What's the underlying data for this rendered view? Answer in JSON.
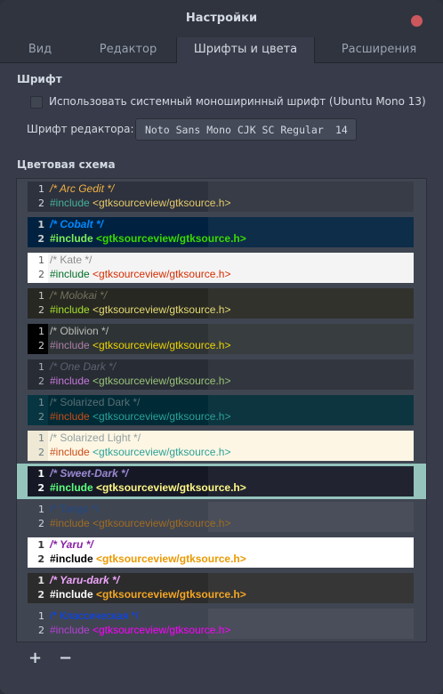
{
  "window": {
    "title": "Настройки"
  },
  "tabs": [
    {
      "label": "Вид"
    },
    {
      "label": "Редактор"
    },
    {
      "label": "Шрифты и цвета"
    },
    {
      "label": "Расширения"
    }
  ],
  "font_section": {
    "heading": "Шрифт",
    "system_font_checkbox": {
      "label": "Использовать системный моноширинный шрифт (Ubuntu Mono 13)",
      "checked": false
    },
    "editor_font_label": "Шрифт редактора:",
    "editor_font": {
      "name": "Noto Sans Mono CJK SC Regular",
      "size": "14"
    }
  },
  "scheme_section": {
    "heading": "Цветовая схема",
    "include_keyword": "#include",
    "include_path": "<gtksourceview/gtksource.h>",
    "schemes": [
      {
        "name": "/* Arc Gedit */",
        "bg": "#2d323e",
        "gutter": "#2d323e",
        "ln": "#d3dae3",
        "comment": "#f3b144",
        "italic": true,
        "kw": "#45b29a",
        "str": "#e7ca6a",
        "bold": false
      },
      {
        "name": "/* Cobalt */",
        "bg": "#002240",
        "gutter": "#002240",
        "ln": "#d0d0d0",
        "comment": "#0088ff",
        "italic": true,
        "kw": "#7cee59",
        "str": "#3ad900",
        "bold": true
      },
      {
        "name": "/* Kate */",
        "bg": "#f4f4f4",
        "gutter": "#ffffff",
        "ln": "#555555",
        "comment": "#8c8c8c",
        "italic": false,
        "kw": "#006e28",
        "str": "#d62d00",
        "bold": false
      },
      {
        "name": "/* Molokai */",
        "bg": "#272822",
        "gutter": "#272822",
        "ln": "#cccccc",
        "comment": "#75715e",
        "italic": true,
        "kw": "#a6e22e",
        "str": "#e6db74",
        "bold": false
      },
      {
        "name": "/* Oblivion */",
        "bg": "#2e3436",
        "gutter": "#000000",
        "ln": "#d3d7cf",
        "comment": "#babdb6",
        "italic": false,
        "kw": "#ad7fa8",
        "str": "#edd400",
        "bold": false
      },
      {
        "name": "/* One Dark */",
        "bg": "#282c34",
        "gutter": "#282c34",
        "ln": "#abb2bf",
        "comment": "#5c6370",
        "italic": true,
        "kw": "#c678dd",
        "str": "#98c379",
        "bold": false
      },
      {
        "name": "/* Solarized Dark */",
        "bg": "#002b36",
        "gutter": "#073642",
        "ln": "#839496",
        "comment": "#586e75",
        "italic": false,
        "kw": "#cb4b16",
        "str": "#2aa198",
        "bold": false
      },
      {
        "name": "/* Solarized Light */",
        "bg": "#fdf6e3",
        "gutter": "#eee8d5",
        "ln": "#657b83",
        "comment": "#93a1a1",
        "italic": false,
        "kw": "#cb4b16",
        "str": "#2aa198",
        "bold": false
      },
      {
        "name": "/* Sweet-Dark */",
        "bg": "#161925",
        "gutter": "#161925",
        "ln": "#ffffff",
        "comment": "#9b89d4",
        "italic": true,
        "kw": "#5cff7f",
        "str": "#fff787",
        "bold": true,
        "selected": true
      },
      {
        "name": "/* Tango */",
        "bg": "#404552",
        "gutter": "#404552",
        "ln": "#d3dae3",
        "comment": "#204a87",
        "italic": false,
        "kw": "#a16d1e",
        "str": "#a16d1e",
        "bold": false
      },
      {
        "name": "/* Yaru */",
        "bg": "#ffffff",
        "gutter": "#ffffff",
        "ln": "#333333",
        "comment": "#8a1fa6",
        "italic": true,
        "kw": "#000000",
        "str": "#ea9a00",
        "bold": true
      },
      {
        "name": "/* Yaru-dark */",
        "bg": "#2c2c2c",
        "gutter": "#2c2c2c",
        "ln": "#e6e6e6",
        "comment": "#f0a5ff",
        "italic": true,
        "kw": "#ffffff",
        "str": "#f4a623",
        "bold": true
      },
      {
        "name": "/* Классическая */",
        "bg": "#404552",
        "gutter": "#404552",
        "ln": "#d3dae3",
        "comment": "#0044ff",
        "italic": false,
        "kw": "#b540d6",
        "str": "#ff00ff",
        "bold": false
      }
    ]
  },
  "bottom": {
    "add_label": "+",
    "remove_label": "−"
  }
}
